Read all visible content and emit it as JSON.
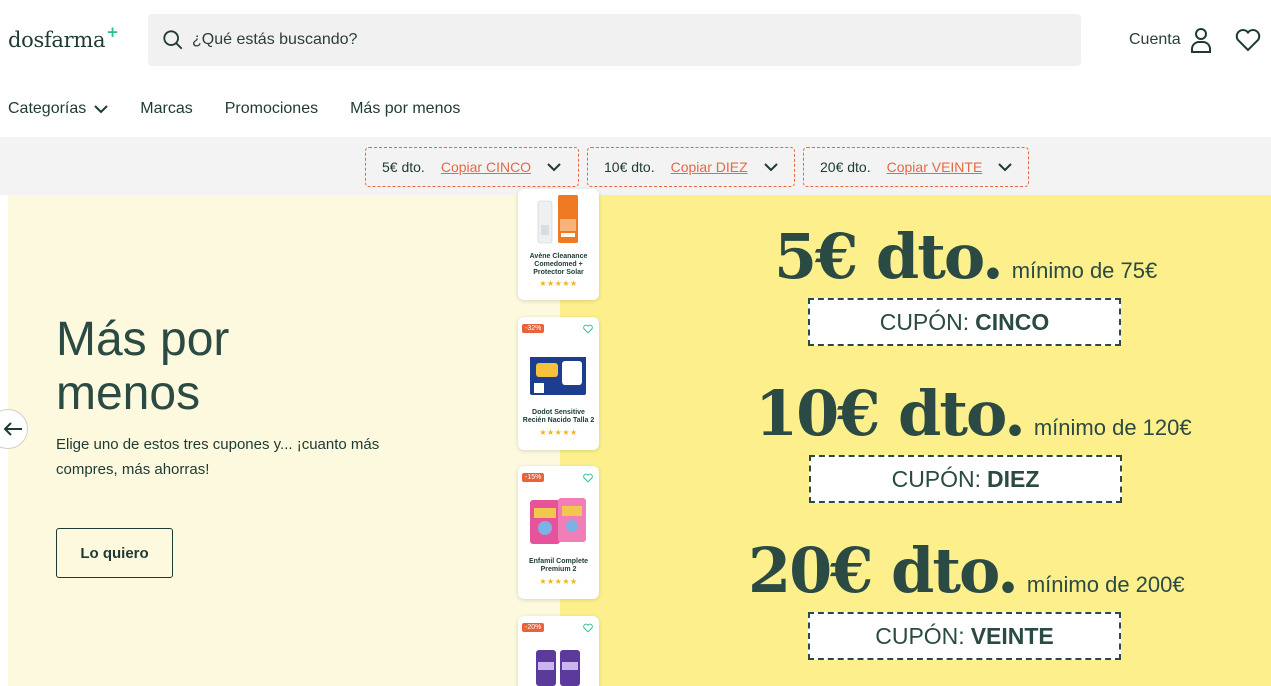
{
  "header": {
    "logo": "dosfarma",
    "logo_plus": "+",
    "search_placeholder": "¿Qué estás buscando?",
    "account_label": "Cuenta"
  },
  "nav": {
    "categories": "Categorías",
    "brands": "Marcas",
    "promotions": "Promociones",
    "more_for_less": "Más por menos"
  },
  "coupon_bar": [
    {
      "amount": "5€ dto.",
      "copy": "Copiar CINCO"
    },
    {
      "amount": "10€ dto.",
      "copy": "Copiar DIEZ"
    },
    {
      "amount": "20€ dto.",
      "copy": "Copiar VEINTE"
    }
  ],
  "hero": {
    "title": "Más por menos",
    "text": "Elige uno de estos tres cupones y... ¡cuanto más compres, más ahorras!",
    "cta": "Lo quiero"
  },
  "products": [
    {
      "name": "Avène Cleanance Comedomed + Protector Solar",
      "discount": "",
      "stars": "★★★★★"
    },
    {
      "name": "Dodot Sensitive Recién Nacido Talla 2",
      "discount": "-32%",
      "stars": "★★★★★"
    },
    {
      "name": "Enfamil Complete Premium 2",
      "discount": "-15%",
      "stars": "★★★★★"
    },
    {
      "name": "",
      "discount": "-20%",
      "stars": ""
    }
  ],
  "offers": [
    {
      "big": "5€ dto.",
      "min": "mínimo de 75€",
      "coupon_label": "CUPÓN:",
      "coupon_code": "CINCO"
    },
    {
      "big": "10€ dto.",
      "min": "mínimo de 120€",
      "coupon_label": "CUPÓN:",
      "coupon_code": "DIEZ"
    },
    {
      "big": "20€ dto.",
      "min": "mínimo de 200€",
      "coupon_label": "CUPÓN:",
      "coupon_code": "VEINTE"
    }
  ],
  "colors": {
    "accent": "#e46a45",
    "brand_dark": "#1d3a34",
    "banner_left": "#fdf9de",
    "banner_right": "#fdf08c",
    "star": "#f2b51b"
  }
}
